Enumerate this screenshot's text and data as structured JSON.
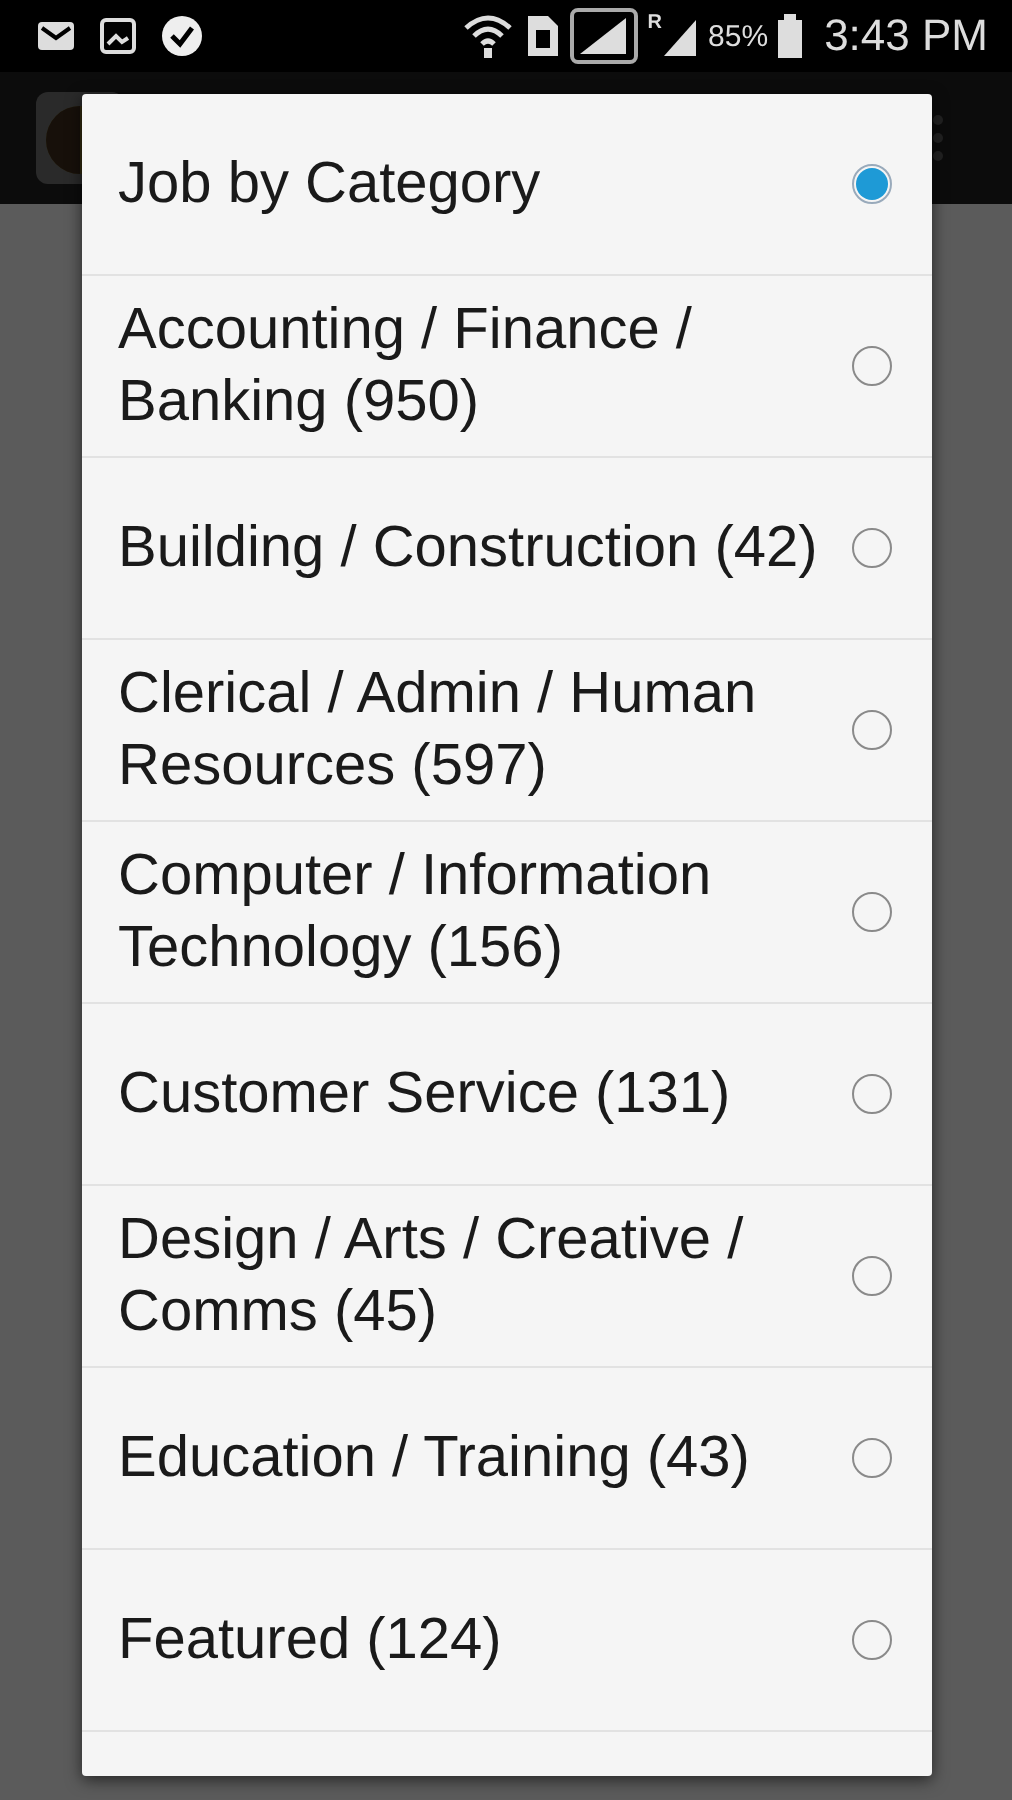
{
  "status_bar": {
    "roaming_mark": "R",
    "battery": "85%",
    "time": "3:43 PM"
  },
  "dialog": {
    "options": [
      {
        "label": "Job by Category",
        "selected": true
      },
      {
        "label": "Accounting / Finance / Banking (950)",
        "selected": false
      },
      {
        "label": "Building / Construction (42)",
        "selected": false
      },
      {
        "label": "Clerical / Admin / Human Resources (597)",
        "selected": false
      },
      {
        "label": "Computer / Information Technology (156)",
        "selected": false
      },
      {
        "label": "Customer Service (131)",
        "selected": false
      },
      {
        "label": "Design / Arts / Creative / Comms (45)",
        "selected": false
      },
      {
        "label": "Education / Training (43)",
        "selected": false
      },
      {
        "label": "Featured (124)",
        "selected": false
      }
    ]
  }
}
